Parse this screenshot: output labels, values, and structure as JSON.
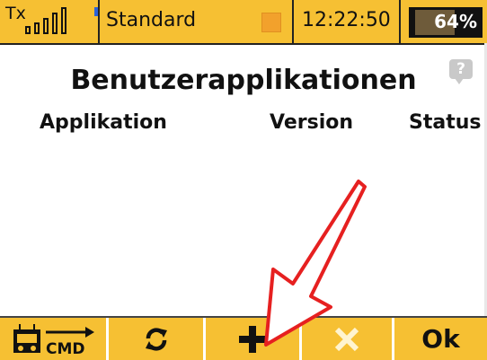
{
  "status_bar": {
    "tx_label": "Tx",
    "model_name": "Standard",
    "time": "12:22:50",
    "battery_percent": 64,
    "battery_label": "64%",
    "icons": {
      "signal": "signal-bars-icon",
      "flight_mode": "flight-mode-indicator",
      "battery": "battery-icon"
    }
  },
  "page": {
    "title": "Benutzerapplikationen",
    "help_icon_glyph": "?"
  },
  "table": {
    "columns": [
      "Applikation",
      "Version",
      "Status"
    ],
    "rows": []
  },
  "bottom_bar": {
    "buttons": [
      {
        "name": "cmd-button",
        "label": "CMD",
        "icon": "transmitter-cmd-icon"
      },
      {
        "name": "refresh-button",
        "icon": "refresh-icon"
      },
      {
        "name": "add-button",
        "icon": "plus-icon"
      },
      {
        "name": "delete-button",
        "icon": "close-icon",
        "disabled": true
      },
      {
        "name": "ok-button",
        "label": "Ok"
      }
    ]
  },
  "colors": {
    "accent": "#f6c033",
    "flight_mode": "#f2a12c",
    "annotation_arrow": "#e62020"
  }
}
